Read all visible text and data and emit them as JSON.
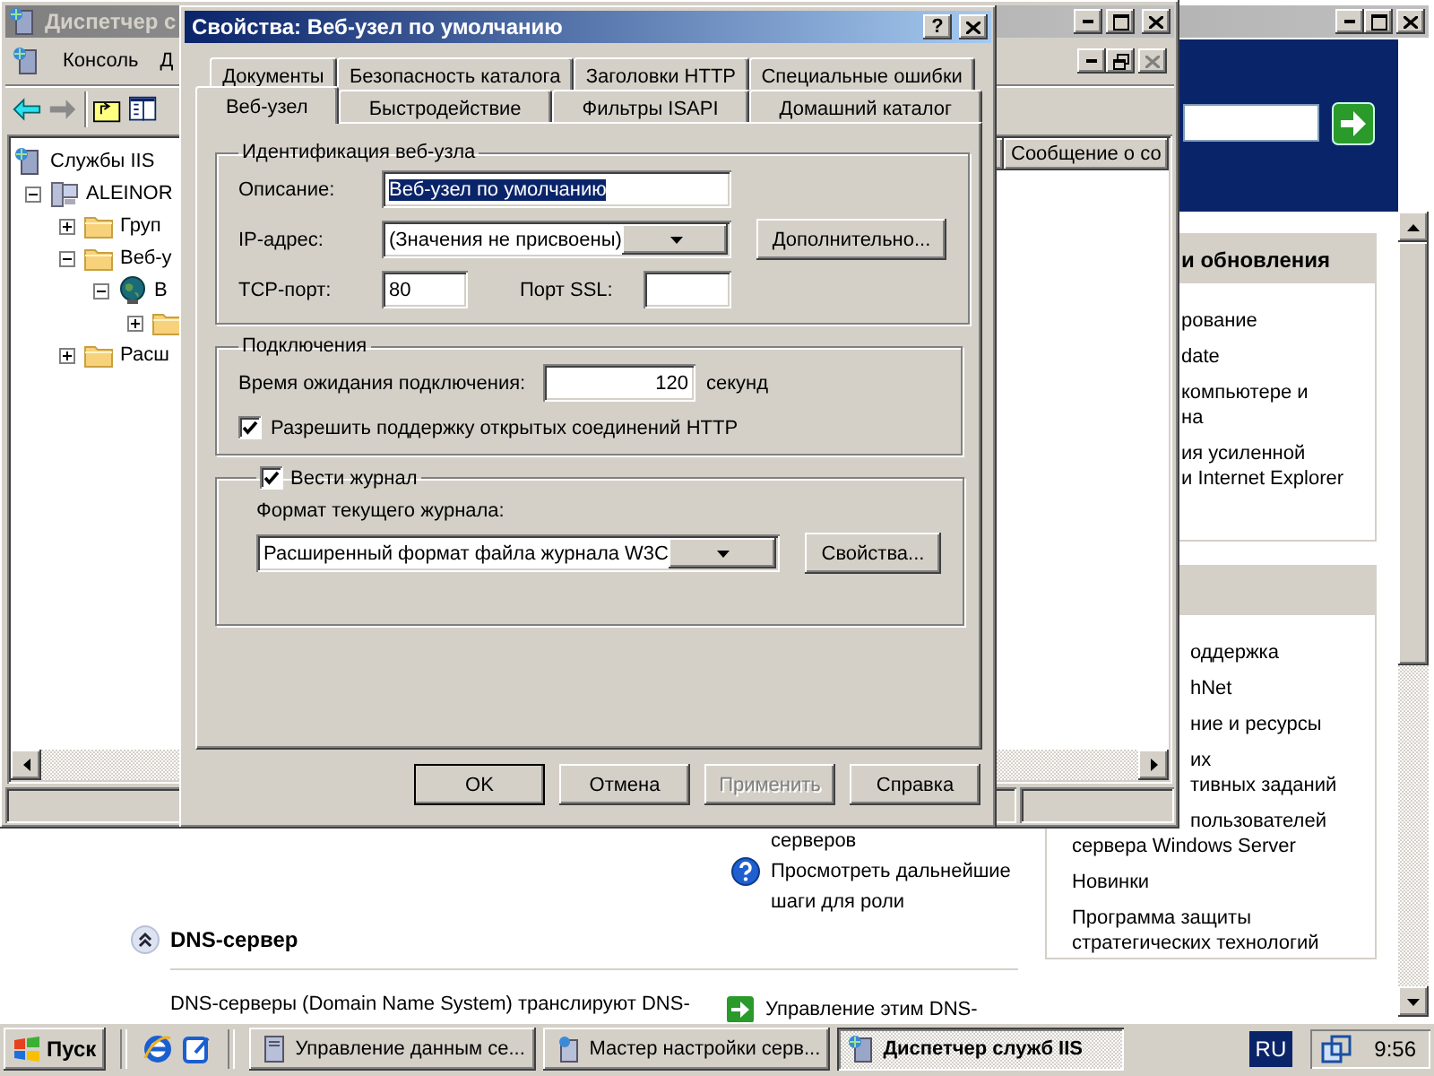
{
  "background_window": {
    "panel_1": {
      "title": "и обновления",
      "covered_items": [
        {
          "lines": [
            "рование"
          ]
        },
        {
          "lines": [
            "date"
          ]
        },
        {
          "lines": [
            "компьютере и",
            "на"
          ]
        },
        {
          "lines": [
            "ия усиленной",
            "и Internet Explorer"
          ]
        }
      ]
    },
    "panel_2": {
      "covered_items": [
        {
          "lines": [
            "оддержка"
          ]
        },
        {
          "lines": [
            "hNet"
          ]
        },
        {
          "lines": [
            "ние и ресурсы"
          ]
        },
        {
          "lines": [
            "их",
            "тивных заданий"
          ]
        },
        {
          "lines": [
            "пользователей"
          ]
        }
      ],
      "items": [
        {
          "lines": [
            "сервера Windows Server"
          ]
        },
        {
          "lines": [
            "Новинки"
          ]
        },
        {
          "lines": [
            "Программа защиты",
            "стратегических технологий"
          ]
        }
      ]
    },
    "cut_text": "серверов",
    "next_steps": {
      "lines": [
        "Просмотреть дальнейшие",
        "шаги для роли"
      ]
    },
    "section": {
      "title": "DNS-сервер",
      "expanded": true,
      "description": "DNS-серверы (Domain Name System) транслируют DNS-",
      "action": "Управление этим DNS-"
    }
  },
  "mmc_window": {
    "title": "Диспетчер с",
    "menu": [
      {
        "label": "Консоль"
      },
      {
        "label": "Д"
      }
    ],
    "tree": [
      {
        "label": "Службы IIS",
        "kind": "service",
        "children": [
          {
            "label": "ALEINOR",
            "kind": "computer",
            "expanded": true,
            "children": [
              {
                "label": "Груп",
                "kind": "folder",
                "expanded": false
              },
              {
                "label": "Веб-у",
                "kind": "folder",
                "expanded": true,
                "children": [
                  {
                    "label": "В",
                    "kind": "site",
                    "expanded": true,
                    "children": [
                      {
                        "kind": "folder",
                        "expanded": false
                      }
                    ]
                  }
                ]
              },
              {
                "label": "Расш",
                "kind": "folder",
                "expanded": false
              }
            ]
          }
        ]
      }
    ],
    "columns": [
      "Сообщение о со"
    ]
  },
  "dialog": {
    "title": "Свойства: Веб-узел по умолчанию",
    "help_button": "?",
    "tab_rows": [
      [
        {
          "label": "Документы",
          "selected": false
        },
        {
          "label": "Безопасность каталога",
          "selected": false
        },
        {
          "label": "Заголовки HTTP",
          "selected": false
        },
        {
          "label": "Специальные ошибки",
          "selected": false
        }
      ],
      [
        {
          "label": "Веб-узел",
          "selected": true
        },
        {
          "label": "Быстродействие",
          "selected": false
        },
        {
          "label": "Фильтры ISAPI",
          "selected": false
        },
        {
          "label": "Домашний каталог",
          "selected": false
        }
      ]
    ],
    "identification": {
      "title": "Идентификация веб-узла",
      "description": {
        "label": "Описание:",
        "value": "Веб-узел по умолчанию",
        "selected": true
      },
      "ip_address": {
        "label": "IP-адрес:",
        "value": "(Значения не присвоены)"
      },
      "advanced_button": "Дополнительно...",
      "tcp_port": {
        "label": "TCP-порт:",
        "value": "80"
      },
      "ssl_port": {
        "label": "Порт SSL:"
      }
    },
    "connections": {
      "title": "Подключения",
      "timeout": {
        "label": "Время ожидания подключения:",
        "value": "120",
        "unit": "секунд"
      },
      "keep_alive": {
        "label": "Разрешить поддержку открытых соединений HTTP",
        "checked": true
      }
    },
    "logging": {
      "label": "Вести журнал",
      "checked": true,
      "format_label": "Формат текущего журнала:",
      "format": "Расширенный формат файла журнала W3C",
      "properties_button": "Свойства..."
    },
    "buttons": [
      {
        "label": "OK",
        "default": true,
        "disabled": false
      },
      {
        "label": "Отмена",
        "default": false,
        "disabled": false
      },
      {
        "label": "Применить",
        "default": false,
        "disabled": true
      },
      {
        "label": "Справка",
        "default": false,
        "disabled": false
      }
    ]
  },
  "taskbar": {
    "start": "Пуск",
    "tasks": [
      {
        "label": "Управление данным се...",
        "kind": "server",
        "selected": false
      },
      {
        "label": "Мастер настройки серв...",
        "kind": "wizard",
        "selected": false
      },
      {
        "label": "Диспетчер служб IIS",
        "kind": "iis",
        "selected": true
      }
    ],
    "language": "RU",
    "clock": "9:56"
  }
}
